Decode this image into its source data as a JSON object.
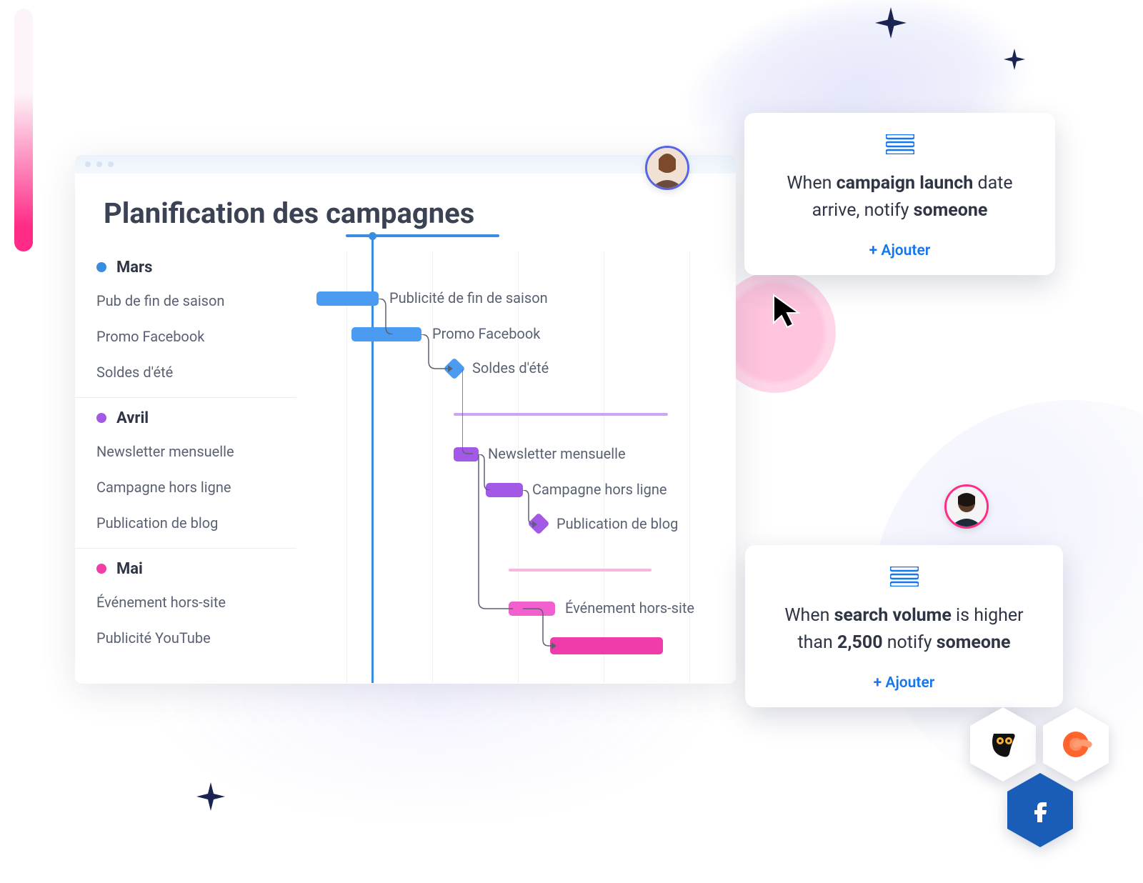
{
  "colors": {
    "blue": "#4b9cf0",
    "purple": "#a259e6",
    "pink": "#f25fcf",
    "accent": "#1676ee"
  },
  "window": {
    "title": "Planification des campagnes"
  },
  "months": [
    {
      "name": "Mars",
      "color": "blue",
      "tasks": [
        {
          "label": "Pub de fin de saison",
          "bar_label": "Publicité de fin de saison",
          "start": 18,
          "end": 105
        },
        {
          "label": "Promo Facebook",
          "bar_label": "Promo Facebook",
          "start": 67,
          "end": 165
        },
        {
          "label": "Soldes d'été",
          "bar_label": "Soldes d'été",
          "milestone": 200
        }
      ]
    },
    {
      "name": "Avril",
      "color": "purple",
      "tasks": [
        {
          "label": "Newsletter mensuelle",
          "bar_label": "Newsletter mensuelle",
          "start": 210,
          "end": 245
        },
        {
          "label": "Campagne hors ligne",
          "bar_label": "Campagne hors ligne",
          "start": 255,
          "end": 307
        },
        {
          "label": "Publication de blog",
          "bar_label": "Publication de blog",
          "milestone": 327
        }
      ]
    },
    {
      "name": "Mai",
      "color": "pink",
      "tasks": [
        {
          "label": "Événement hors-site",
          "bar_label": "Événement hors-site",
          "start": 287,
          "end": 352
        },
        {
          "label": "Publicité YouTube",
          "bar_label": "",
          "start": 345,
          "end": 503
        }
      ]
    }
  ],
  "cards": [
    {
      "rule": {
        "pre": "When ",
        "b1": "campaign launch",
        "mid": " date arrive, notify ",
        "b2": "someone"
      },
      "add_label": "+ Ajouter"
    },
    {
      "rule": {
        "pre": "When ",
        "b1": "search volume",
        "mid": " is higher than ",
        "b2": "2,500",
        "post": " notify ",
        "b3": "someone"
      },
      "add_label": "+ Ajouter"
    }
  ],
  "integrations": [
    "hootsuite",
    "semrush",
    "facebook"
  ]
}
